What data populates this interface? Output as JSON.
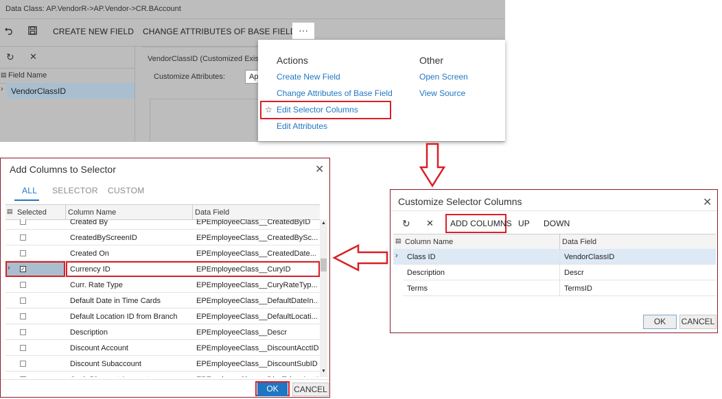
{
  "screen": {
    "title": "Data Class: AP.VendorR->AP.Vendor->CR.BAccount",
    "toolbar": {
      "undo_icon": "undo-icon",
      "save_icon": "save-icon",
      "create_new_field": "CREATE NEW FIELD",
      "change_attributes": "CHANGE ATTRIBUTES OF BASE FIELD",
      "more": "···"
    },
    "left_pane": {
      "refresh_icon": "↻",
      "close_icon": "✕",
      "field_name_header": "Field Name",
      "row": "VendorClassID"
    },
    "right_pane": {
      "heading": "VendorClassID (Customized Existi",
      "customize_attributes_label": "Customize Attributes:",
      "select_value": "Ap"
    }
  },
  "menu": {
    "actions_header": "Actions",
    "actions": [
      "Create New Field",
      "Change Attributes of Base Field",
      "Edit Selector Columns",
      "Edit Attributes"
    ],
    "other_header": "Other",
    "other": [
      "Open Screen",
      "View Source"
    ]
  },
  "customize_dialog": {
    "title": "Customize Selector Columns",
    "toolbar": {
      "add_columns": "ADD COLUMNS",
      "up": "UP",
      "down": "DOWN"
    },
    "columns": [
      "Column Name",
      "Data Field"
    ],
    "rows": [
      {
        "name": "Class ID",
        "field": "VendorClassID"
      },
      {
        "name": "Description",
        "field": "Descr"
      },
      {
        "name": "Terms",
        "field": "TermsID"
      }
    ],
    "ok": "OK",
    "cancel": "CANCEL"
  },
  "add_dialog": {
    "title": "Add Columns to Selector",
    "tabs": [
      "ALL",
      "SELECTOR",
      "CUSTOM"
    ],
    "columns": [
      "Selected",
      "Column Name",
      "Data Field"
    ],
    "rows": [
      {
        "name": "Created By",
        "field": "EPEmployeeClass__CreatedByID",
        "checked": false
      },
      {
        "name": "CreatedByScreenID",
        "field": "EPEmployeeClass__CreatedBySc...",
        "checked": false
      },
      {
        "name": "Created On",
        "field": "EPEmployeeClass__CreatedDate...",
        "checked": false
      },
      {
        "name": "Currency ID",
        "field": "EPEmployeeClass__CuryID",
        "checked": true
      },
      {
        "name": "Curr. Rate Type",
        "field": "EPEmployeeClass__CuryRateTyp...",
        "checked": false
      },
      {
        "name": "Default Date in Time Cards",
        "field": "EPEmployeeClass__DefaultDateIn...",
        "checked": false
      },
      {
        "name": "Default Location ID from Branch",
        "field": "EPEmployeeClass__DefaultLocati...",
        "checked": false
      },
      {
        "name": "Description",
        "field": "EPEmployeeClass__Descr",
        "checked": false
      },
      {
        "name": "Discount Account",
        "field": "EPEmployeeClass__DiscountAcctID",
        "checked": false
      },
      {
        "name": "Discount Subaccount",
        "field": "EPEmployeeClass__DiscountSubID",
        "checked": false
      },
      {
        "name": "Cash Discount Account",
        "field": "EPEmployeeClass__DiscTakenAcctID",
        "checked": false
      }
    ],
    "ok": "OK",
    "cancel": "CANCEL"
  },
  "colors": {
    "accent": "#1f76c2",
    "highlight": "#d91e25",
    "dim": "#bdbdbd",
    "selected_row": "#dde9f5"
  }
}
